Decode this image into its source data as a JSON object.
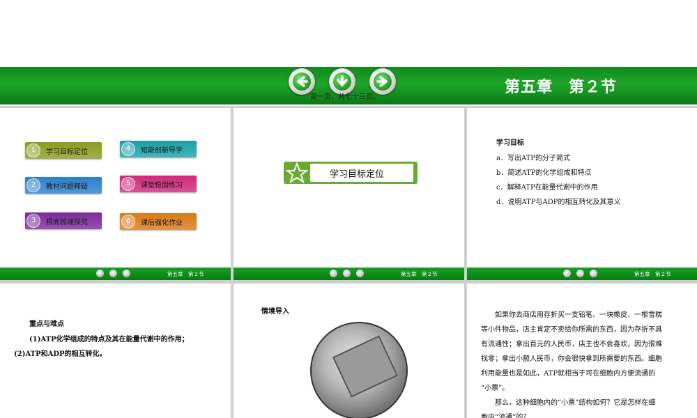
{
  "header": {
    "chapter_title": "第五章　第２节",
    "page_indicator": "第一页，共七十三页。"
  },
  "nav_buttons": [
    "back-button",
    "home-button",
    "forward-button"
  ],
  "footer": {
    "label": "第五章　第２节"
  },
  "panel1": {
    "menu": [
      {
        "num": "1",
        "label": "学习目标定位",
        "color": "#8a9c20"
      },
      {
        "num": "2",
        "label": "教材问题释疑",
        "color": "#2a7fcc"
      },
      {
        "num": "3",
        "label": "根底梳理探究",
        "color": "#7a2a9a"
      },
      {
        "num": "4",
        "label": "知能创新导学",
        "color": "#1aa0a8"
      },
      {
        "num": "5",
        "label": "课堂稳固练习",
        "color": "#d0287a"
      },
      {
        "num": "6",
        "label": "课后强化作业",
        "color": "#d87a18"
      }
    ]
  },
  "panel2": {
    "banner": "学习目标定位"
  },
  "panel3": {
    "heading": "学习目标",
    "goals": [
      "a．写出ATP的分子简式",
      "b．简述ATP的化学组成和特点",
      "c．解释ATP在能量代谢中的作用",
      "d．说明ATP与ADP的相互转化及其意义"
    ]
  },
  "panel4": {
    "heading": "重点与难点",
    "line1": "(1)ATP化学组成的特点及其在能量代谢中的作用；",
    "line2": "(2)ATP和ADP的相互转化。"
  },
  "panel5": {
    "heading": "情境导入"
  },
  "panel6": {
    "lines": [
      "如果你去商店用存折买一支铅笔、一块橡皮、一根雪糕",
      "等小件物品，店主肯定不卖给你所需的东西，因为存折不具",
      "有流通性；拿出百元的人民币，店主也不会喜欢，因为很难",
      "找零；拿出小额人民币，你会很快拿到所需要的东西。细胞",
      "利用能量也是如此，ATP就相当于可在细胞内方便流通的",
      "“小票”。",
      "那么，这种细胞内的“小票”结构如何？它是怎样在细",
      "胞内“流通”的？"
    ]
  },
  "colors": {
    "header_green": "#1a9a24",
    "star_green": "#6aaa30"
  }
}
